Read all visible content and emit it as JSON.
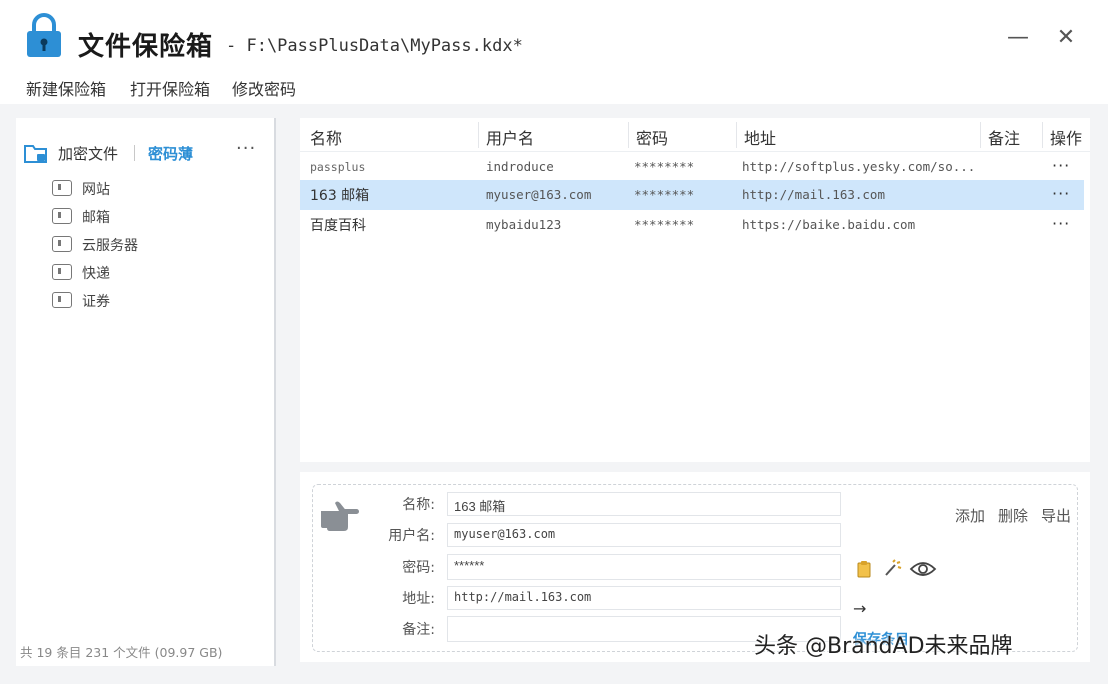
{
  "app": {
    "title": "文件保险箱",
    "file_path": "- F:\\PassPlusData\\MyPass.kdx*"
  },
  "window": {
    "minimize": "—",
    "close": "✕"
  },
  "menu": [
    "新建保险箱",
    "打开保险箱",
    "修改密码"
  ],
  "sidebar": {
    "tab_encrypt": "加密文件",
    "tab_password": "密码薄",
    "more": "···",
    "categories": [
      "网站",
      "邮箱",
      "云服务器",
      "快递",
      "证券"
    ],
    "footer": "共 19 条目  231 个文件 (09.97 GB)"
  },
  "table": {
    "headers": [
      "名称",
      "用户名",
      "密码",
      "地址",
      "备注",
      "操作"
    ],
    "rows": [
      {
        "name": "passplus",
        "user": "indroduce",
        "password": "********",
        "url": "http://softplus.yesky.com/so...",
        "note": "",
        "more": "···"
      },
      {
        "name": "163 邮箱",
        "user": "myuser@163.com",
        "password": "********",
        "url": "http://mail.163.com",
        "note": "",
        "more": "···"
      },
      {
        "name": "百度百科",
        "user": "mybaidu123",
        "password": "********",
        "url": "https://baike.baidu.com",
        "note": "",
        "more": "···"
      }
    ],
    "selected_row": 1
  },
  "detail": {
    "labels": {
      "name": "名称:",
      "user": "用户名:",
      "password": "密码:",
      "url": "地址:",
      "note": "备注:"
    },
    "values": {
      "name": "163 邮箱",
      "user": "myuser@163.com",
      "password": "******",
      "url": "http://mail.163.com",
      "note": ""
    },
    "actions": {
      "add": "添加",
      "delete": "删除",
      "export": "导出"
    },
    "arrow": "→",
    "save": "保存条目"
  },
  "watermark": "头条 @BrandAD未来品牌",
  "colors": {
    "accent": "#2d8fd5",
    "selected_row": "#cfe6fb"
  }
}
